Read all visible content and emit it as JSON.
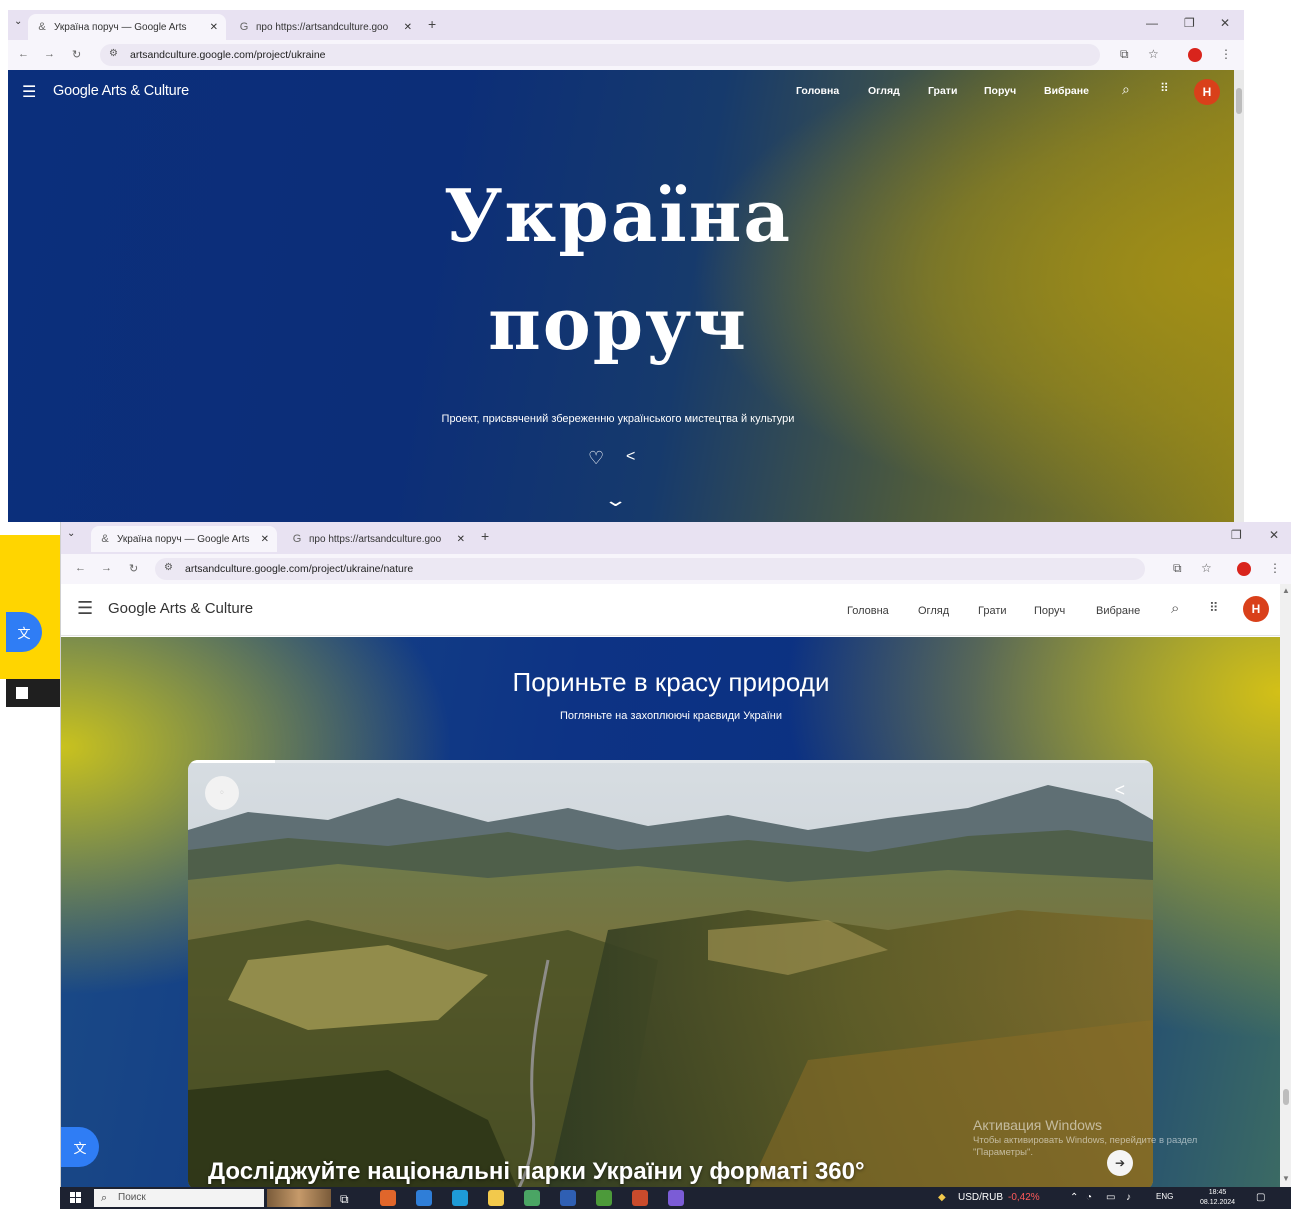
{
  "window1": {
    "tabs": [
      {
        "title": "Україна поруч — Google Arts",
        "active": true
      },
      {
        "title": "про https://artsandculture.goo",
        "active": false
      }
    ],
    "url": "artsandculture.google.com/project/ukraine",
    "nav_links": [
      "Головна",
      "Огляд",
      "Грати",
      "Поруч",
      "Вибране"
    ],
    "brand": "Google Arts & Culture",
    "avatar_letter": "Н",
    "hero_title_line1": "Україна",
    "hero_title_line2": "поруч",
    "hero_subtitle": "Проект, присвячений збереженню українського мистецтва й культури"
  },
  "window2": {
    "tabs": [
      {
        "title": "Україна поруч — Google Arts",
        "active": true
      },
      {
        "title": "про https://artsandculture.goo",
        "active": false
      }
    ],
    "url": "artsandculture.google.com/project/ukraine/nature",
    "nav_links": [
      "Головна",
      "Огляд",
      "Грати",
      "Поруч",
      "Вибране"
    ],
    "brand": "Google Arts & Culture",
    "avatar_letter": "Н",
    "section_title": "Пориньте в красу природи",
    "section_subtitle": "Погляньте на захоплюючі краєвиди України",
    "card_title": "Досліджуйте національні парки України у форматі 360°",
    "slide_progress": 0.09,
    "activation_title": "Активация Windows",
    "activation_text": "Чтобы активировать Windows, перейдите в раздел \"Параметры\"."
  },
  "taskbar": {
    "search_placeholder": "Поиск",
    "currency": "USD/RUB",
    "currency_change": "-0,42%",
    "language": "ENG",
    "time": "18:45",
    "date": "08.12.2024"
  },
  "colors": {
    "hero_blue": "#0c2e78",
    "hero_olive": "#a28f16",
    "avatar_red": "#d9401a",
    "tab_bar": "#e8e2f2",
    "taskbar": "#1d2231"
  }
}
